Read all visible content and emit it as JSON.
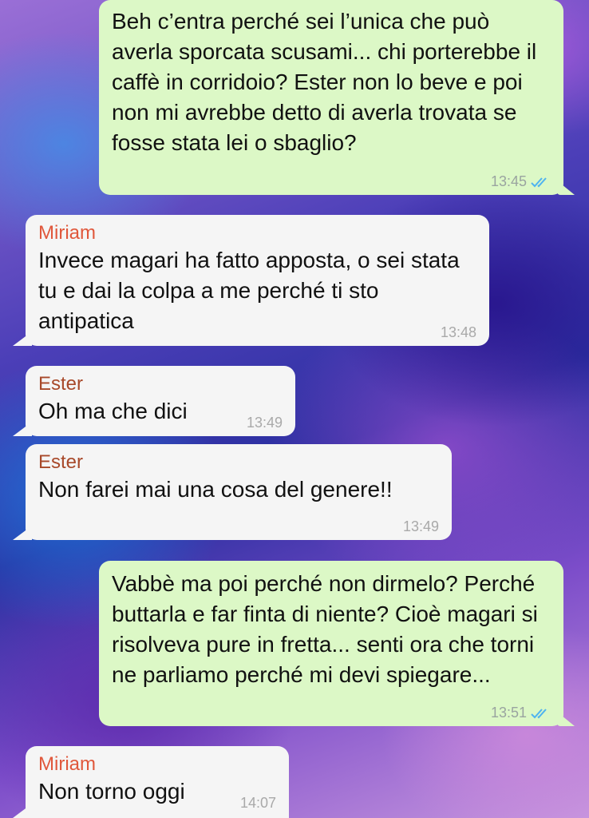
{
  "messages": [
    {
      "direction": "out",
      "text": "Beh c’entra perché sei l’unica che può averla sporcata scusami... chi porterebbe il caffè in corridoio? Ester non lo beve e poi non mi avrebbe detto di averla trovata se fosse stata lei o sbaglio?",
      "time": "13:45",
      "status": "read"
    },
    {
      "direction": "in",
      "sender": "Miriam",
      "text": "Invece magari ha fatto apposta, o sei stata tu e dai la colpa a me perché ti sto antipatica",
      "time": "13:48"
    },
    {
      "direction": "in",
      "sender": "Ester",
      "text": "Oh ma che dici",
      "time": "13:49"
    },
    {
      "direction": "in",
      "sender": "Ester",
      "text": "Non farei mai una cosa del genere!!",
      "time": "13:49"
    },
    {
      "direction": "out",
      "text": "Vabbè ma poi perché non dirmelo? Perché buttarla e far finta di niente? Cioè magari si risolveva pure in fretta... senti ora che torni ne parliamo perché mi devi spiegare...",
      "time": "13:51",
      "status": "read"
    },
    {
      "direction": "in",
      "sender": "Miriam",
      "text": "Non torno oggi",
      "time": "14:07"
    }
  ],
  "colors": {
    "outgoing_bubble": "#dcf8c6",
    "incoming_bubble": "#f5f5f5",
    "sender_miriam": "#e0573b",
    "sender_ester": "#a8492a",
    "read_ticks": "#4fb3f0"
  },
  "icons": {
    "read_status": "double-check-icon"
  }
}
